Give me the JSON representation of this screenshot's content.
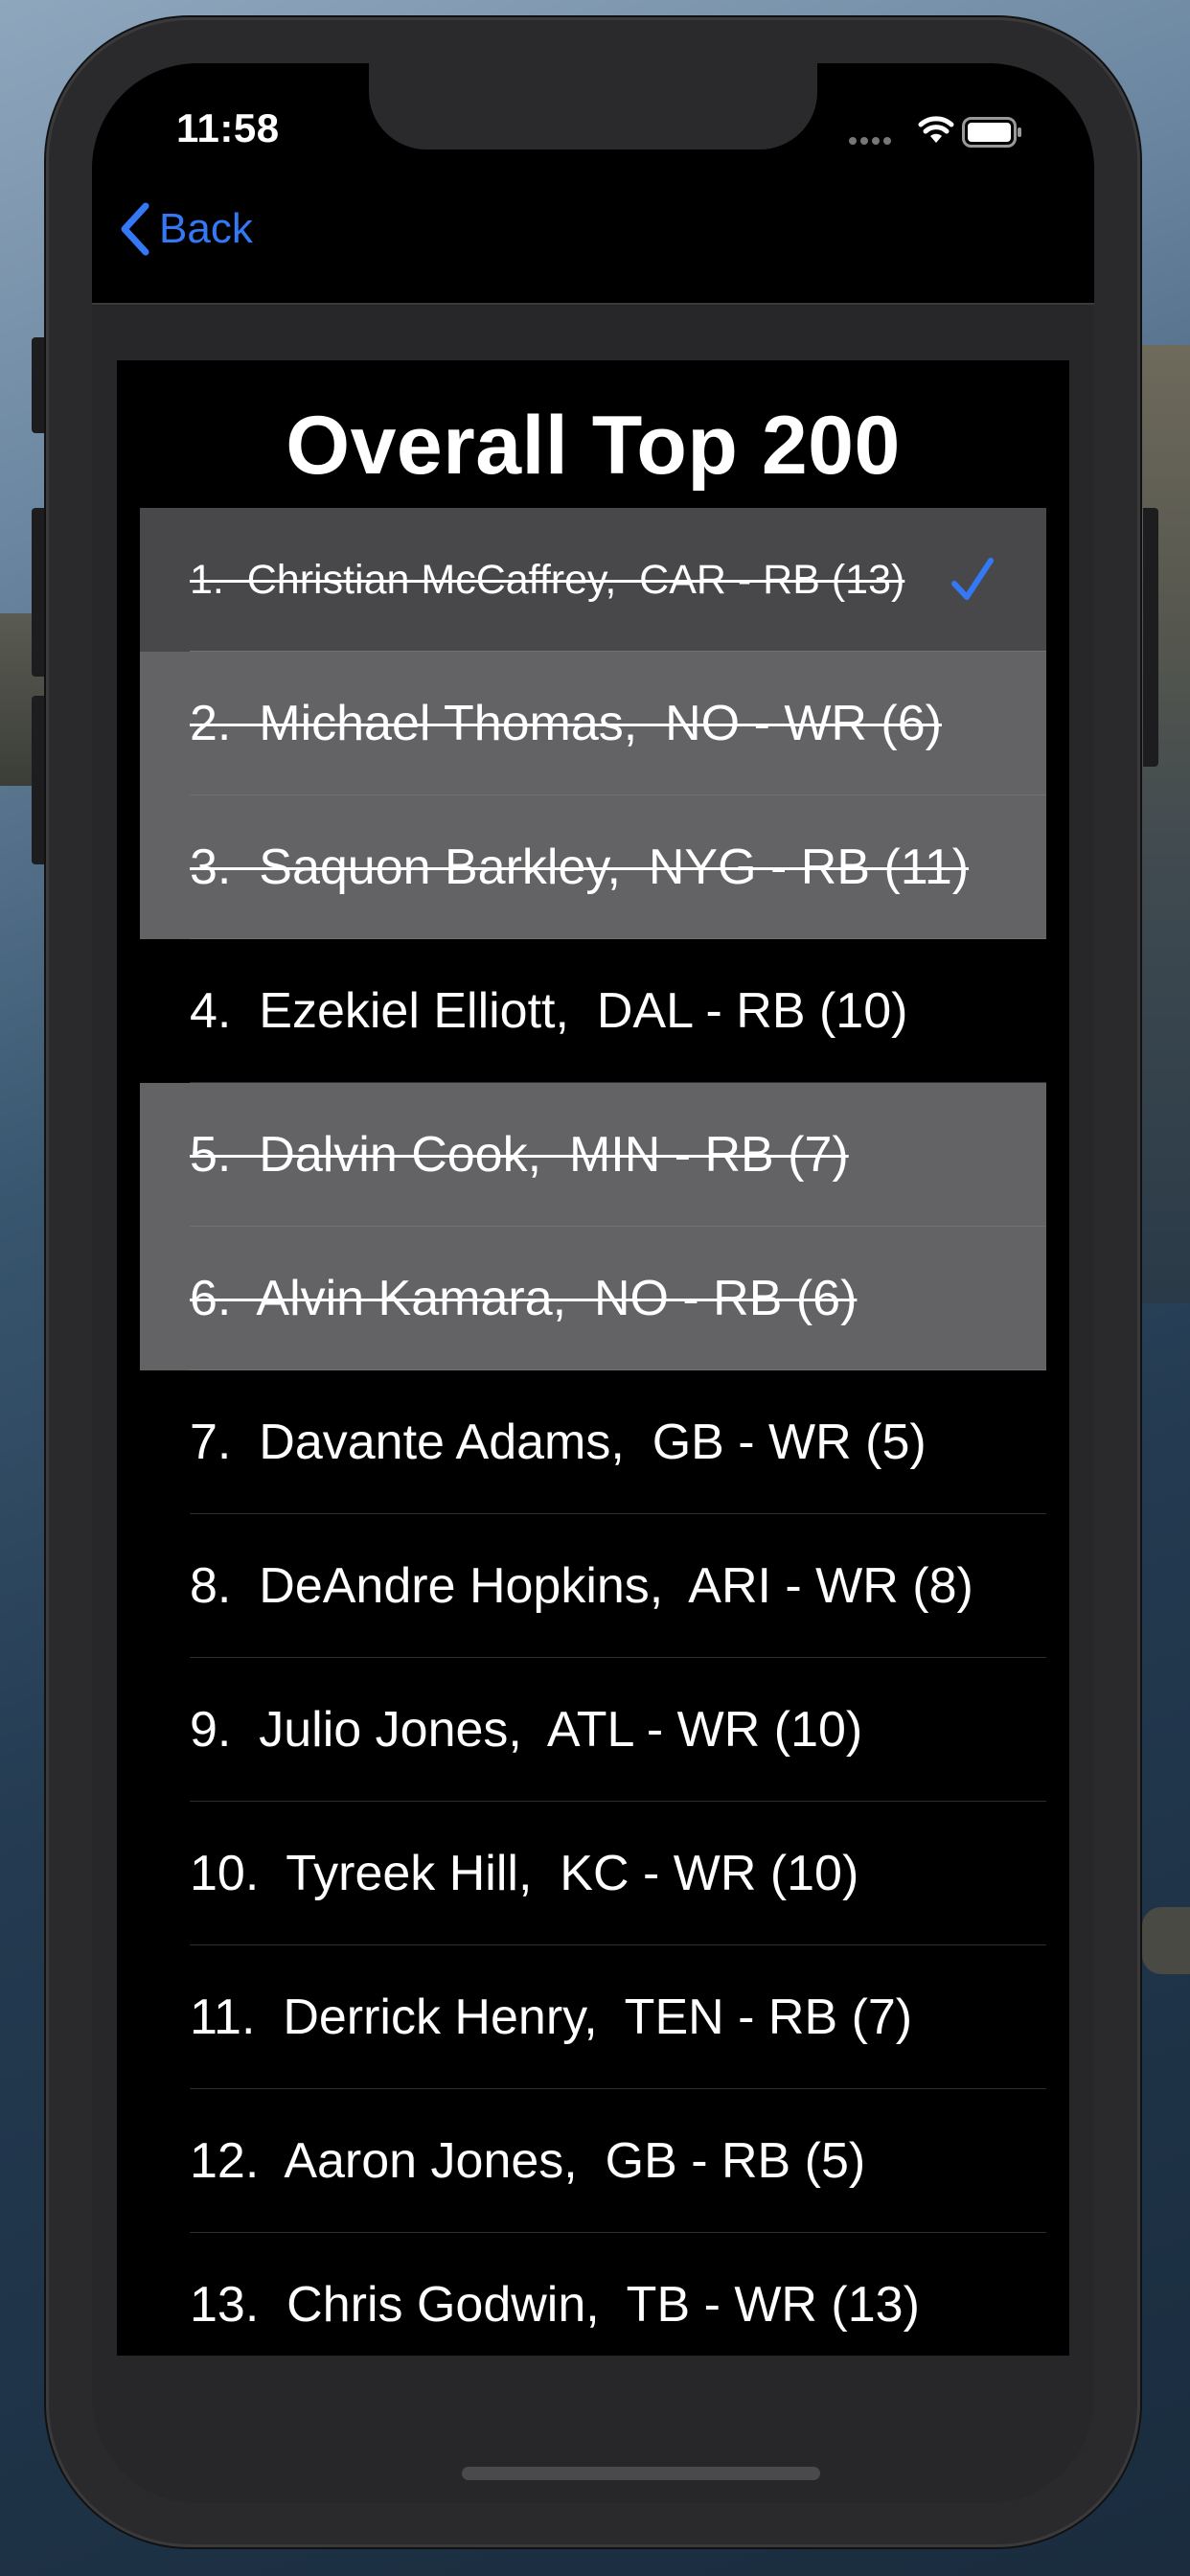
{
  "status_bar": {
    "time": "11:58"
  },
  "nav": {
    "back_label": "Back"
  },
  "page": {
    "title": "Overall Top 200"
  },
  "players": [
    {
      "label": "1.  Christian McCaffrey,  CAR - RB (13)",
      "drafted": true,
      "selected": true
    },
    {
      "label": "2.  Michael Thomas,  NO - WR (6)",
      "drafted": true,
      "selected": false
    },
    {
      "label": "3.  Saquon Barkley,  NYG - RB (11)",
      "drafted": true,
      "selected": false
    },
    {
      "label": "4.  Ezekiel Elliott,  DAL - RB (10)",
      "drafted": false,
      "selected": false
    },
    {
      "label": "5.  Dalvin Cook,  MIN - RB (7)",
      "drafted": true,
      "selected": false
    },
    {
      "label": "6.  Alvin Kamara,  NO - RB (6)",
      "drafted": true,
      "selected": false
    },
    {
      "label": "7.  Davante Adams,  GB - WR (5)",
      "drafted": false,
      "selected": false
    },
    {
      "label": "8.  DeAndre Hopkins,  ARI - WR (8)",
      "drafted": false,
      "selected": false
    },
    {
      "label": "9.  Julio Jones,  ATL - WR (10)",
      "drafted": false,
      "selected": false
    },
    {
      "label": "10.  Tyreek Hill,  KC - WR (10)",
      "drafted": false,
      "selected": false
    },
    {
      "label": "11.  Derrick Henry,  TEN - RB (7)",
      "drafted": false,
      "selected": false
    },
    {
      "label": "12.  Aaron Jones,  GB - RB (5)",
      "drafted": false,
      "selected": false
    },
    {
      "label": "13.  Chris Godwin,  TB - WR (13)",
      "drafted": false,
      "selected": false
    }
  ],
  "icons": {
    "back": "chevron-left-icon",
    "check": "checkmark-icon",
    "wifi": "wifi-icon",
    "battery": "battery-icon",
    "signal": "signal-dots-icon"
  },
  "colors": {
    "accent": "#3478f6",
    "drafted_row": "#636366",
    "selected_row": "#48484a",
    "panel": "#000000"
  }
}
